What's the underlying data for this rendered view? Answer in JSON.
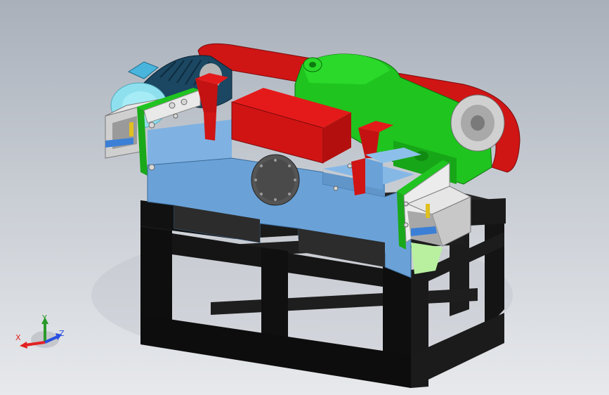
{
  "triad": {
    "x_label": "X",
    "y_label": "Y",
    "z_label": "Z"
  },
  "colors": {
    "background_top": "#a9b0ba",
    "background_bottom": "#e7e9ec",
    "frame": "#0c0c0c",
    "housing": "#6aa2d8",
    "hopper": "#e01818",
    "gearbox": "#19c219",
    "belt": "#d41616",
    "motor": "#1c4660",
    "fan": "#8fe0ef",
    "panel": "#c8c8c8"
  },
  "icons": [
    "axis-triad-icon"
  ]
}
